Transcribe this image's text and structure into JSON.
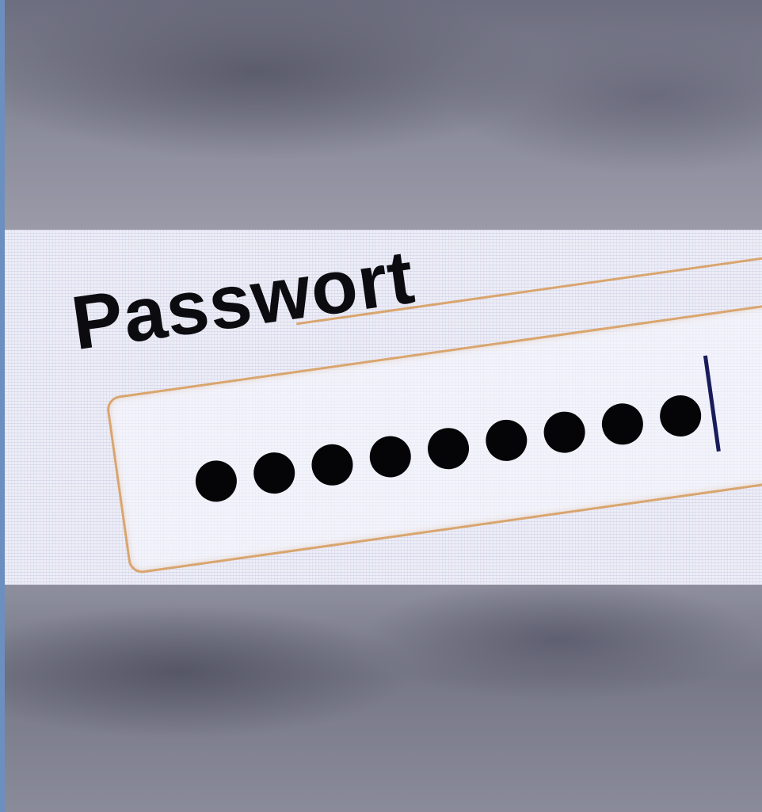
{
  "password_form": {
    "label": "Passwort",
    "masked_char_count": 9,
    "colors": {
      "field_border": "#d9a56e",
      "text": "#0c0c10",
      "caret": "#1a1c5a",
      "background": "#eceef7"
    }
  }
}
